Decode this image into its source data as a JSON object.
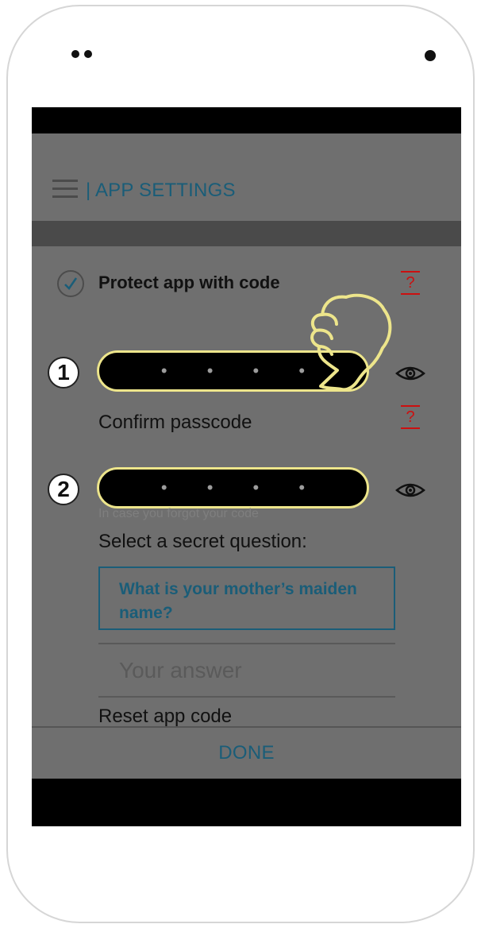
{
  "header": {
    "title": "| APP SETTINGS"
  },
  "settings": {
    "protect_label": "Protect app with code",
    "help_symbol": "?",
    "passcode_dots": "• • • •",
    "confirm_label": "Confirm passcode",
    "forgot_label": "In case you forgot your code",
    "select_label": "Select a secret question:",
    "secret_question": "What is your mother’s maiden name?",
    "answer_placeholder": "Your answer",
    "reset_label": "Reset app code"
  },
  "badges": {
    "step1": "1",
    "step2": "2"
  },
  "footer": {
    "done_label": "DONE"
  },
  "colors": {
    "accent": "#1a5d78",
    "help": "#cc1010",
    "highlight": "#ede58b"
  },
  "icons": {
    "menu": "hamburger-menu-icon",
    "check": "checkmark-icon",
    "show_password": "eye-icon",
    "pointer": "pointing-hand-icon"
  }
}
